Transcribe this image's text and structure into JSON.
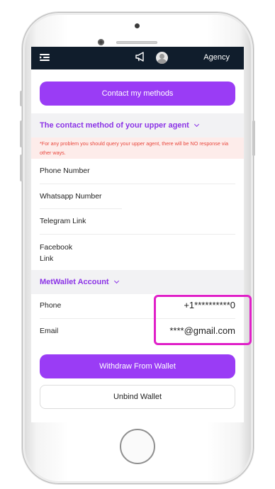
{
  "header": {
    "menu_icon": "menu-icon",
    "announcement_icon": "megaphone-icon",
    "avatar_icon": "user-avatar-icon",
    "agency_label": "Agency"
  },
  "contact_button_label": "Contact my methods",
  "upper_agent": {
    "title": "The contact method of your upper agent",
    "notice": "*For any problem you should query your upper agent, there will be NO response via other ways.",
    "fields": [
      "Phone Number",
      "Whatsapp Number",
      "Telegram Link",
      "Facebook Link"
    ]
  },
  "metwallet": {
    "title": "MetWallet Account",
    "phone_label": "Phone",
    "phone_value": "+1**********0",
    "email_label": "Email",
    "email_value": "****@gmail.com"
  },
  "withdraw_button_label": "Withdraw From Wallet",
  "unbind_button_label": "Unbind Wallet",
  "colors": {
    "accent": "#9a3cf5",
    "topbar": "#101d2c",
    "notice_text": "#e8473d",
    "highlight": "#e01fc8"
  }
}
